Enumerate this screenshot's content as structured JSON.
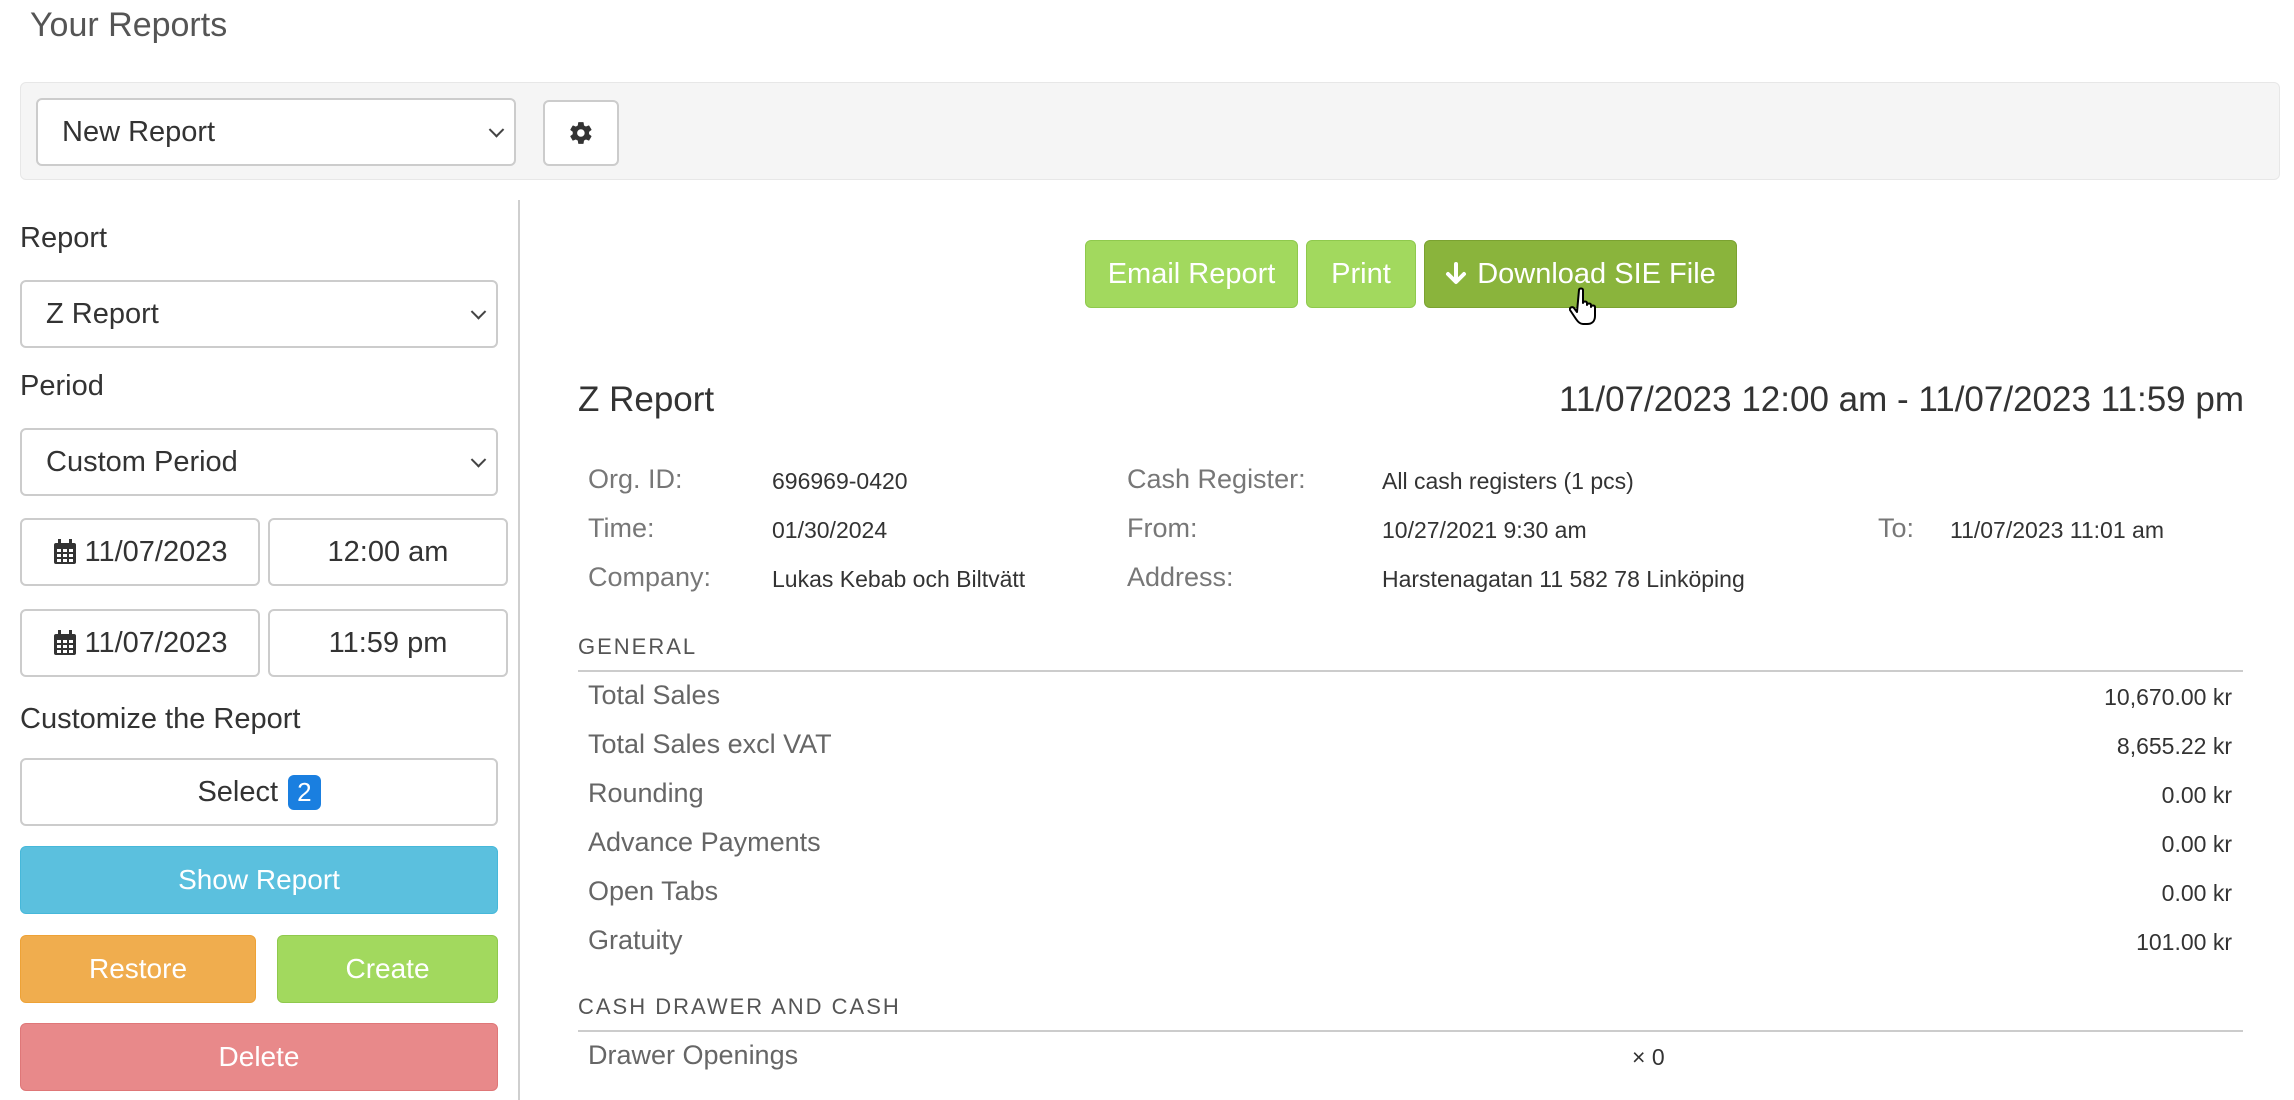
{
  "page_title": "Your Reports",
  "toolbar": {
    "report_select_value": "New Report",
    "settings_icon": "gear-icon"
  },
  "sidebar": {
    "report_label": "Report",
    "report_value": "Z Report",
    "period_label": "Period",
    "period_value": "Custom Period",
    "start_date": "11/07/2023",
    "start_time": "12:00 am",
    "end_date": "11/07/2023",
    "end_time": "11:59 pm",
    "customize_label": "Customize the Report",
    "select_label": "Select",
    "select_count": "2",
    "show_report": "Show Report",
    "restore": "Restore",
    "create": "Create",
    "delete": "Delete"
  },
  "actions": {
    "email": "Email Report",
    "print": "Print",
    "download": "Download SIE File"
  },
  "report": {
    "title": "Z Report",
    "range": "11/07/2023 12:00 am - 11/07/2023 11:59 pm",
    "info": {
      "org_id_label": "Org. ID:",
      "org_id": "696969-0420",
      "cash_register_label": "Cash Register:",
      "cash_register": "All cash registers (1 pcs)",
      "time_label": "Time:",
      "time": "01/30/2024",
      "from_label": "From:",
      "from": "10/27/2021 9:30 am",
      "to_label": "To:",
      "to": "11/07/2023 11:01 am",
      "company_label": "Company:",
      "company": "Lukas Kebab och Biltvätt",
      "address_label": "Address:",
      "address": "Harstenagatan 11 582 78 Linköping"
    },
    "general_heading": "GENERAL",
    "general_rows": [
      {
        "label": "Total Sales",
        "value": "10,670.00 kr"
      },
      {
        "label": "Total Sales excl VAT",
        "value": "8,655.22 kr"
      },
      {
        "label": "Rounding",
        "value": "0.00 kr"
      },
      {
        "label": "Advance Payments",
        "value": "0.00 kr"
      },
      {
        "label": "Open Tabs",
        "value": "0.00 kr"
      },
      {
        "label": "Gratuity",
        "value": "101.00 kr"
      }
    ],
    "cash_heading": "CASH DRAWER AND CASH",
    "cash_rows": [
      {
        "label": "Drawer Openings",
        "value": "× 0"
      }
    ]
  },
  "colors": {
    "accent_blue": "#5bc0de",
    "warning": "#f0ad4e",
    "success_light": "#a2d95e",
    "success_dark": "#8ab43c",
    "danger": "#e8898a",
    "badge": "#1a7fe0"
  }
}
